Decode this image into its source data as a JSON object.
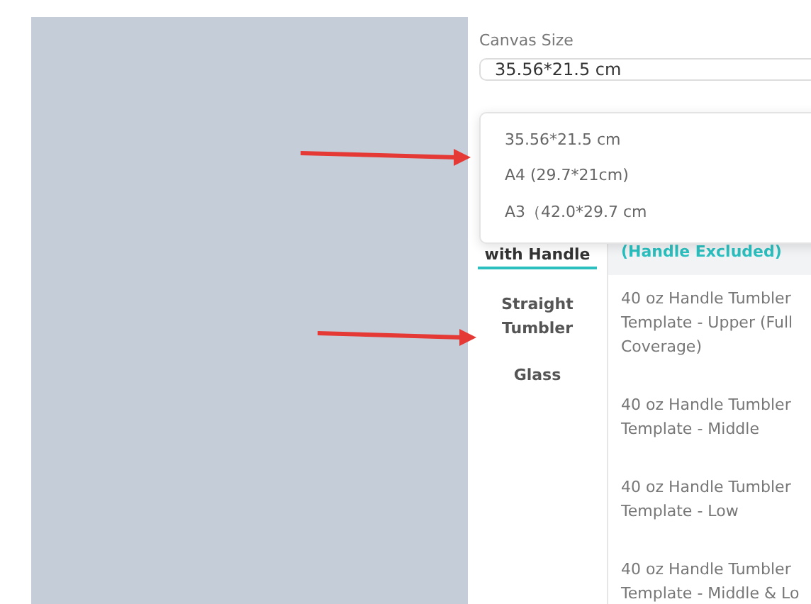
{
  "canvas_size": {
    "label": "Canvas Size",
    "value": "35.56*21.5 cm"
  },
  "dropdown": {
    "options": [
      {
        "label": "35.56*21.5 cm",
        "selected": false
      },
      {
        "label": "A4 (29.7*21cm)",
        "selected": false
      },
      {
        "label": "A3（42.0*29.7 cm",
        "selected": false
      }
    ]
  },
  "categories": [
    {
      "label": "with Handle",
      "selected": true
    },
    {
      "label": "Straight Tumbler",
      "selected": false
    },
    {
      "label": "Glass",
      "selected": false
    }
  ],
  "templates": [
    {
      "label": "(Handle Excluded)",
      "selected": true
    },
    {
      "label": "40 oz Handle Tumbler Template - Upper (Full Coverage)",
      "selected": false
    },
    {
      "label": "40 oz Handle Tumbler Template - Middle",
      "selected": false
    },
    {
      "label": "40 oz Handle Tumbler Template - Low",
      "selected": false
    },
    {
      "label": "40 oz Handle Tumbler Template - Middle & Lo",
      "selected": false
    }
  ]
}
